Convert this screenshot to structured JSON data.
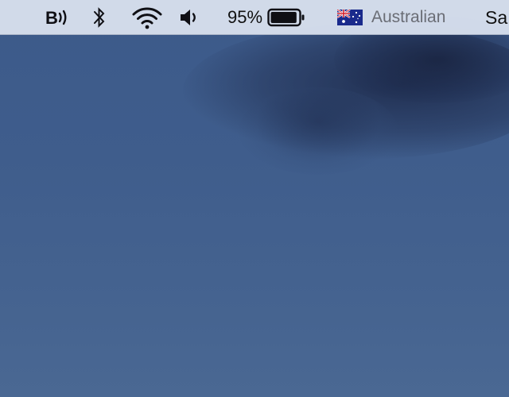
{
  "menubar": {
    "battery_percent_label": "95%",
    "battery_level": 0.95,
    "input_source_label": "Australian",
    "clock_partial": "Sa"
  },
  "icons": {
    "beats": "beats-bluetooth-icon",
    "bluetooth": "bluetooth-icon",
    "wifi": "wifi-icon",
    "volume": "volume-icon",
    "battery": "battery-icon",
    "flag": "australia-flag-icon"
  },
  "colors": {
    "menubar_bg": "#d6deec",
    "icon": "#0f0f14",
    "input_label": "#6a6d75",
    "desktop": "#3f5d8c"
  }
}
